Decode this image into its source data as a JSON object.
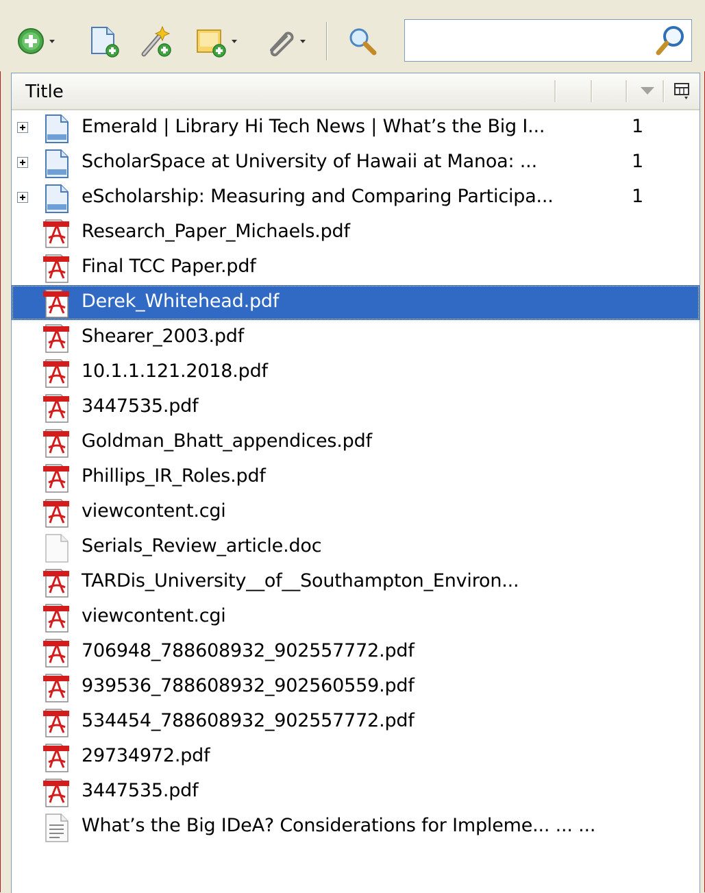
{
  "toolbar": {
    "new_item_icon": "green-plus-icon",
    "new_item_from_id_icon": "new-document-icon",
    "new_note_icon": "wand-icon",
    "add_attachment_icon": "new-folder-icon",
    "link_icon": "paperclip-icon",
    "advanced_search_icon": "magnifier-icon",
    "search": {
      "value": "",
      "placeholder": ""
    }
  },
  "columns": {
    "title": "Title"
  },
  "items": [
    {
      "icon": "webpage-icon",
      "expandable": true,
      "title": "Emerald | Library Hi Tech News | What’s the Big I...",
      "count": "1"
    },
    {
      "icon": "webpage-icon",
      "expandable": true,
      "title": "ScholarSpace at University of Hawaii at Manoa: ...",
      "count": "1"
    },
    {
      "icon": "webpage-icon",
      "expandable": true,
      "title": "eScholarship: Measuring and Comparing Participa...",
      "count": "1"
    },
    {
      "icon": "pdf-icon",
      "title": "Research_Paper_Michaels.pdf"
    },
    {
      "icon": "pdf-icon",
      "title": "Final TCC Paper.pdf"
    },
    {
      "icon": "pdf-icon",
      "title": "Derek_Whitehead.pdf",
      "selected": true
    },
    {
      "icon": "pdf-icon",
      "title": "Shearer_2003.pdf"
    },
    {
      "icon": "pdf-icon",
      "title": "10.1.1.121.2018.pdf"
    },
    {
      "icon": "pdf-icon",
      "title": "3447535.pdf"
    },
    {
      "icon": "pdf-icon",
      "title": "Goldman_Bhatt_appendices.pdf"
    },
    {
      "icon": "pdf-icon",
      "title": "Phillips_IR_Roles.pdf"
    },
    {
      "icon": "pdf-icon",
      "title": "viewcontent.cgi"
    },
    {
      "icon": "blank-file-icon",
      "title": "Serials_Review_article.doc"
    },
    {
      "icon": "pdf-icon",
      "title": "TARDis_University__of__Southampton_Environ..."
    },
    {
      "icon": "pdf-icon",
      "title": "viewcontent.cgi"
    },
    {
      "icon": "pdf-icon",
      "title": "706948_788608932_902557772.pdf"
    },
    {
      "icon": "pdf-icon",
      "title": "939536_788608932_902560559.pdf"
    },
    {
      "icon": "pdf-icon",
      "title": "534454_788608932_902557772.pdf"
    },
    {
      "icon": "pdf-icon",
      "title": "29734972.pdf"
    },
    {
      "icon": "pdf-icon",
      "title": "3447535.pdf"
    },
    {
      "icon": "text-document-icon",
      "title": "What’s the Big IDeA? Considerations for Impleme...  ...   ..."
    }
  ],
  "colors": {
    "selection": "#316ac5",
    "pdf_red": "#d41c1c"
  }
}
